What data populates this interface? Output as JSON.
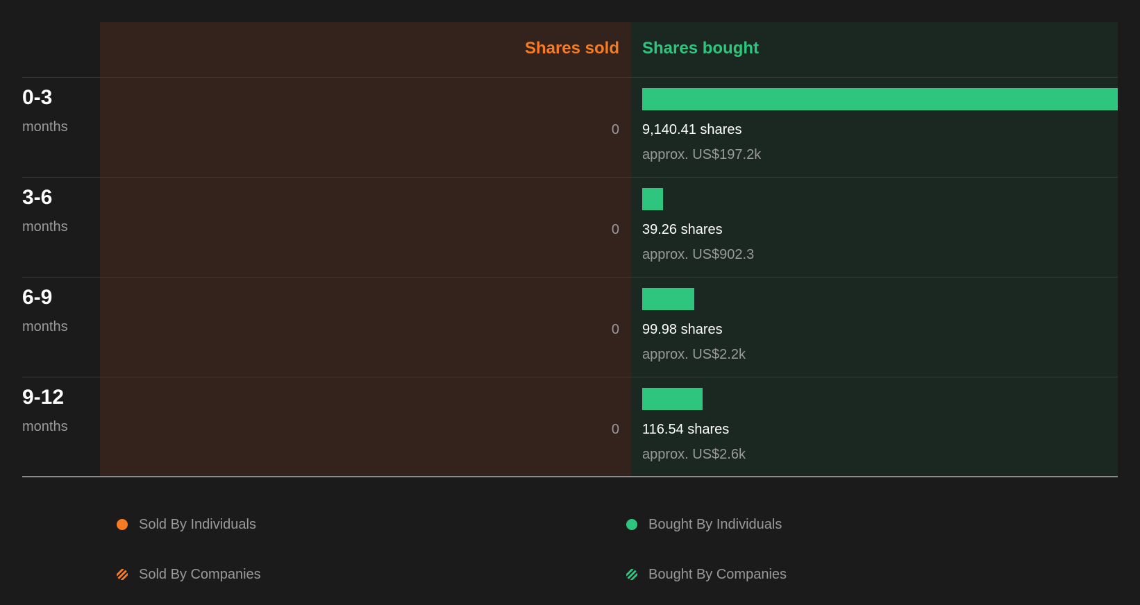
{
  "chart_data": {
    "type": "bar",
    "orientation": "horizontal-diverging",
    "column_headers": {
      "sold": "Shares sold",
      "bought": "Shares bought"
    },
    "categories": [
      {
        "period": "0-3",
        "unit": "months"
      },
      {
        "period": "3-6",
        "unit": "months"
      },
      {
        "period": "6-9",
        "unit": "months"
      },
      {
        "period": "9-12",
        "unit": "months"
      }
    ],
    "series": [
      {
        "name": "Shares sold",
        "values": [
          0,
          0,
          0,
          0
        ],
        "labels": [
          "0",
          "0",
          "0",
          "0"
        ],
        "color": "#f57c22"
      },
      {
        "name": "Shares bought",
        "values": [
          9140.41,
          39.26,
          99.98,
          116.54
        ],
        "labels": [
          "9,140.41 shares",
          "39.26 shares",
          "99.98 shares",
          "116.54 shares"
        ],
        "usd_labels": [
          "approx. US$197.2k",
          "approx. US$902.3",
          "approx. US$2.2k",
          "approx. US$2.6k"
        ],
        "color": "#2ec57f"
      }
    ],
    "legend": {
      "placement": "bottom",
      "items": [
        {
          "label": "Sold By Individuals",
          "color": "#f57c22",
          "pattern": "solid"
        },
        {
          "label": "Bought By Individuals",
          "color": "#2ec57f",
          "pattern": "solid"
        },
        {
          "label": "Sold By Companies",
          "color": "#f57c22",
          "pattern": "striped"
        },
        {
          "label": "Bought By Companies",
          "color": "#2ec57f",
          "pattern": "striped"
        }
      ]
    }
  },
  "colors": {
    "background": "#1b1b1c",
    "sold_panel": "#33231c",
    "bought_panel": "#1b2822",
    "sold_accent": "#f57c22",
    "bought_accent": "#2ec57f"
  }
}
